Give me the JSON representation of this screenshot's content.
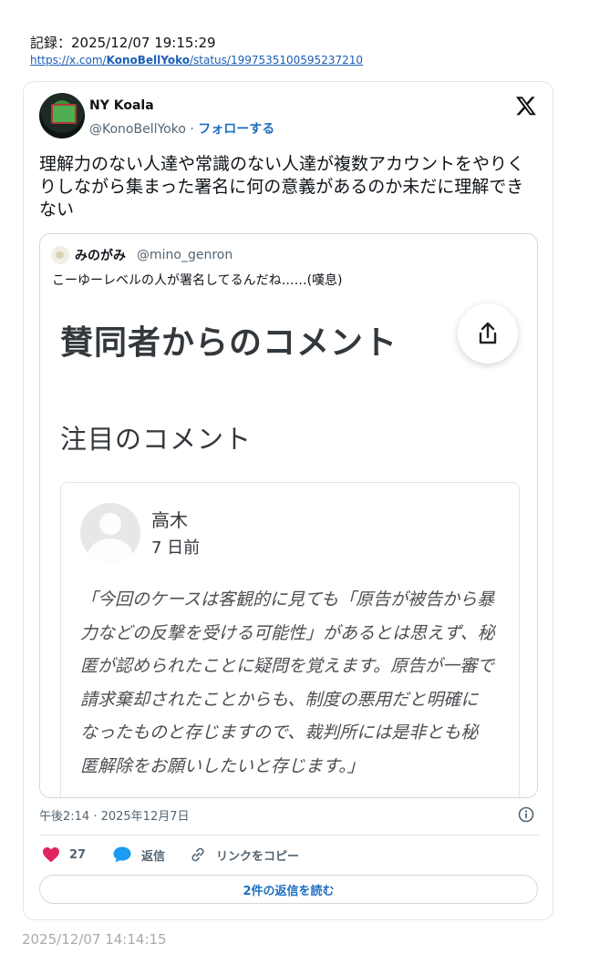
{
  "record": {
    "label": "記録：2025/12/07 19:15:29",
    "url_prefix": "https://x.com/",
    "url_user": "KonoBellYoko",
    "url_suffix": "/status/1997535100595237210"
  },
  "tweet": {
    "author_name": "NY Koala",
    "author_handle": "@KonoBellYoko",
    "separator": " · ",
    "follow_label": "フォローする",
    "text": "理解力のない人達や常識のない人達が複数アカウントをやりくりしながら集まった署名に何の意義があるのか未だに理解できない",
    "timestamp": "午後2:14 · 2025年12月7日",
    "likes": "27",
    "reply_label": "返信",
    "copy_link_label": "リンクをコピー",
    "read_replies_label": "2件の返信を読む",
    "icons": [
      "x-logo-icon",
      "info-icon",
      "heart-icon",
      "reply-bubble-icon",
      "link-icon"
    ]
  },
  "quoted": {
    "author_name": "みのがみ",
    "author_handle": "@mino_genron",
    "text": "こーゆーレベルの人が署名してるんだね……(嘆息)",
    "image": {
      "heading": "賛同者からのコメント",
      "subheading": "注目のコメント",
      "comment_name": "高木",
      "comment_date": "7 日前",
      "comment_body": "「今回のケースは客観的に見ても「原告が被告から暴力などの反撃を受ける可能性」があるとは思えず、秘匿が認められたことに疑問を覚えます。原告が一審で請求棄却されたことからも、制度の悪用だと明確になったものと存じますので、裁判所には是非とも秘匿解除をお願いしたいと存じます。」"
    }
  },
  "footer": {
    "archived_at": "2025/12/07 14:14:15"
  },
  "colors": {
    "link": "#1d6fc0",
    "like": "#e0245e",
    "reply": "#1d9bf0",
    "muted": "#536471"
  }
}
